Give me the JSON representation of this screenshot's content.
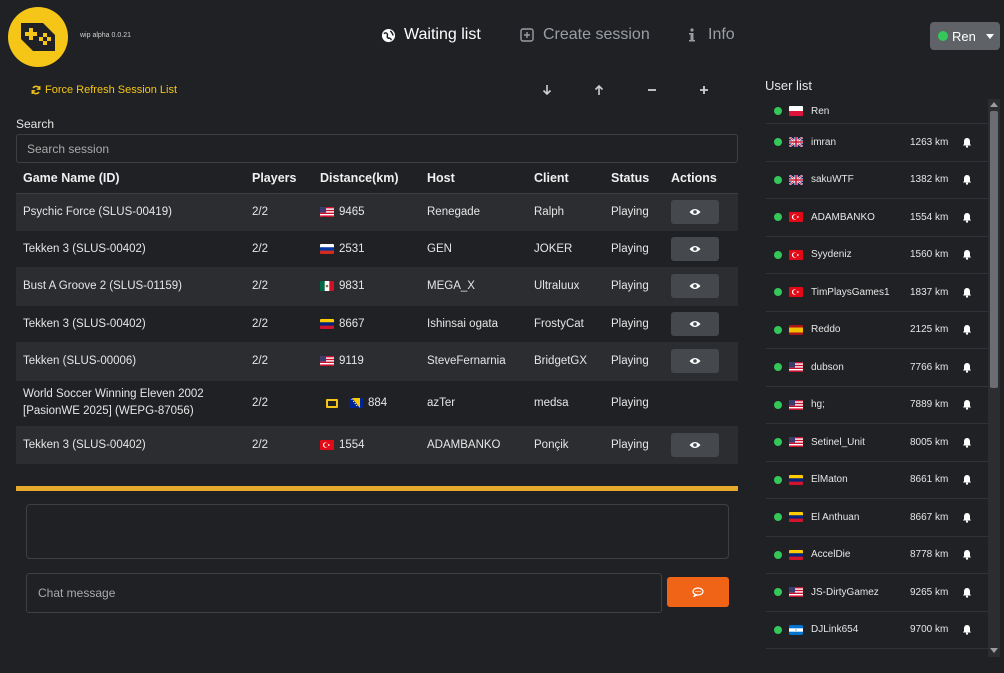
{
  "app": {
    "version": "wip alpha 0.0.21",
    "logo_color": "#f5c518",
    "accent": "#f5c518",
    "send_color": "#f06418"
  },
  "nav": {
    "waiting_list": "Waiting list",
    "create_session": "Create session",
    "info": "Info",
    "user_button": "Ren"
  },
  "toolbar": {
    "refresh_label": "Force Refresh Session List",
    "sort_controls": [
      "arrow-down-icon",
      "arrow-up-icon",
      "minus-icon",
      "plus-icon"
    ]
  },
  "search": {
    "label": "Search",
    "placeholder": "Search session"
  },
  "table": {
    "headers": [
      "Game Name (ID)",
      "Players",
      "Distance(km)",
      "Host",
      "Client",
      "Status",
      "Actions"
    ],
    "rows": [
      {
        "game": "Psychic Force (SLUS-00419)",
        "players": "2/2",
        "flag": "us",
        "distance": "9465",
        "host": "Renegade",
        "client": "Ralph",
        "status": "Playing",
        "action": "eye-icon"
      },
      {
        "game": "Tekken 3 (SLUS-00402)",
        "players": "2/2",
        "flag": "ru",
        "distance": "2531",
        "host": "GEN",
        "client": "JOKER",
        "status": "Playing",
        "action": "eye-icon"
      },
      {
        "game": "Bust A Groove 2 (SLUS-01159)",
        "players": "2/2",
        "flag": "mx",
        "distance": "9831",
        "host": "MEGA_X",
        "client": "Ultraluux",
        "status": "Playing",
        "action": "eye-icon"
      },
      {
        "game": "Tekken 3 (SLUS-00402)",
        "players": "2/2",
        "flag": "ve",
        "distance": "8667",
        "host": "Ishinsai ogata",
        "client": "FrostyCat",
        "status": "Playing",
        "action": "eye-icon"
      },
      {
        "game": "Tekken (SLUS-00006)",
        "players": "2/2",
        "flag": "us",
        "distance": "9119",
        "host": "SteveFernarnia",
        "client": "BridgetGX",
        "status": "Playing",
        "action": "eye-icon"
      },
      {
        "game": "World Soccer Winning Eleven 2002 [PasionWE 2025] (WEPG-87056)",
        "players": "2/2",
        "flag": "ba",
        "distance": "884",
        "host": "azTer",
        "client": "medsa",
        "status": "Playing",
        "action": "none"
      },
      {
        "game": "Tekken 3 (SLUS-00402)",
        "players": "2/2",
        "flag": "tr",
        "distance": "1554",
        "host": "ADAMBANKO",
        "client": "Ponçik",
        "status": "Playing",
        "action": "eye-icon"
      }
    ]
  },
  "chat": {
    "placeholder": "Chat message",
    "send_icon": "chat-icon"
  },
  "user_list": {
    "title": "User list",
    "users": [
      {
        "name": "Ren",
        "flag": "pl",
        "km": ""
      },
      {
        "name": "imran",
        "flag": "gb",
        "km": "1263 km"
      },
      {
        "name": "sakuWTF",
        "flag": "gb",
        "km": "1382 km"
      },
      {
        "name": "ADAMBANKO",
        "flag": "tr",
        "km": "1554 km"
      },
      {
        "name": "Syydeniz",
        "flag": "tr",
        "km": "1560 km"
      },
      {
        "name": "TimPlaysGames1",
        "flag": "tr",
        "km": "1837 km"
      },
      {
        "name": "Reddo",
        "flag": "es",
        "km": "2125 km"
      },
      {
        "name": "dubson",
        "flag": "us",
        "km": "7766 km"
      },
      {
        "name": "hg;",
        "flag": "us",
        "km": "7889 km"
      },
      {
        "name": "Setinel_Unit",
        "flag": "us",
        "km": "8005 km"
      },
      {
        "name": "ElMaton",
        "flag": "ve",
        "km": "8661 km"
      },
      {
        "name": "El Anthuan",
        "flag": "ve",
        "km": "8667 km"
      },
      {
        "name": "AccelDie",
        "flag": "ve",
        "km": "8778 km"
      },
      {
        "name": "JS-DirtyGamez",
        "flag": "us",
        "km": "9265 km"
      },
      {
        "name": "DJLink654",
        "flag": "hn",
        "km": "9700 km"
      }
    ]
  }
}
